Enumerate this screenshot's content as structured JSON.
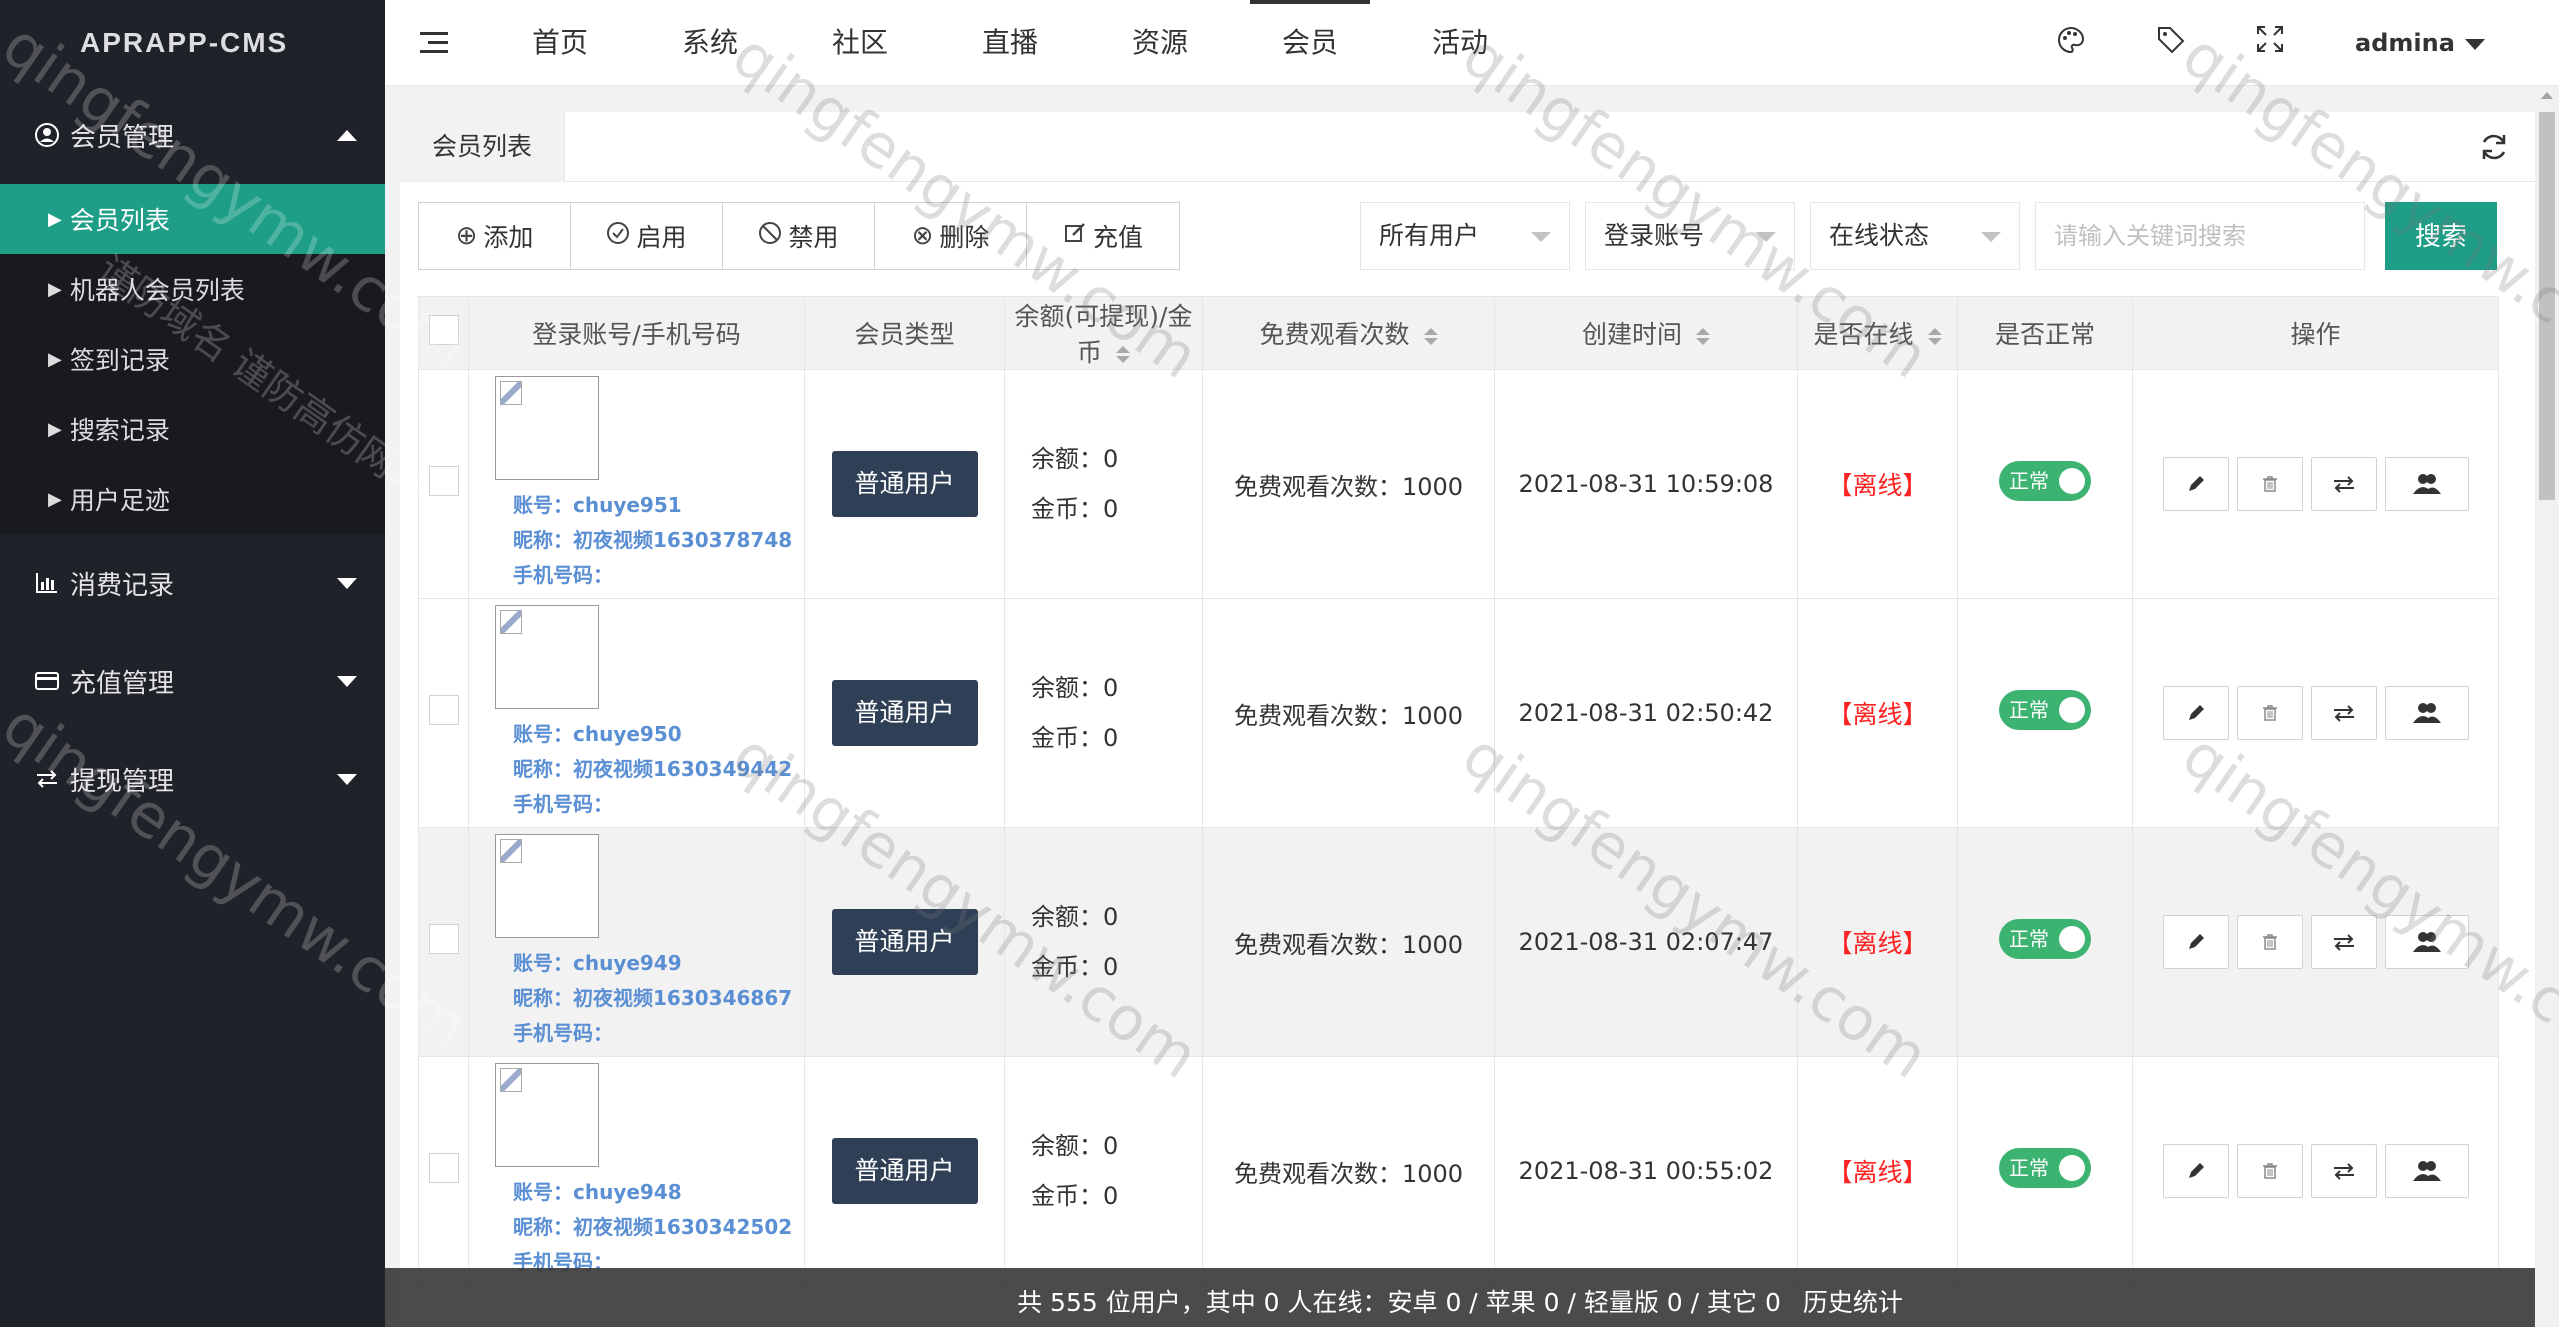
{
  "app": {
    "title": "APRAPP-CMS"
  },
  "sidebar": {
    "groups": [
      {
        "label": "会员管理",
        "icon": "user-circle-icon",
        "expanded": true,
        "items": [
          {
            "label": "会员列表",
            "active": true
          },
          {
            "label": "机器人会员列表"
          },
          {
            "label": "签到记录"
          },
          {
            "label": "搜索记录"
          },
          {
            "label": "用户足迹"
          }
        ]
      },
      {
        "label": "消费记录",
        "icon": "bar-chart-icon",
        "expanded": false
      },
      {
        "label": "充值管理",
        "icon": "card-icon",
        "expanded": false
      },
      {
        "label": "提现管理",
        "icon": "exchange-icon",
        "expanded": false
      }
    ]
  },
  "header": {
    "nav": [
      "首页",
      "系统",
      "社区",
      "直播",
      "资源",
      "会员",
      "活动"
    ],
    "active_nav": "会员",
    "user": "admina",
    "icons": [
      "palette-icon",
      "tag-icon",
      "fullscreen-icon"
    ]
  },
  "tabs": [
    {
      "label": "会员列表"
    }
  ],
  "toolbar": {
    "buttons": [
      {
        "label": "添加",
        "icon": "plus-circle-icon"
      },
      {
        "label": "启用",
        "icon": "check-circle-icon"
      },
      {
        "label": "禁用",
        "icon": "ban-icon"
      },
      {
        "label": "删除",
        "icon": "x-circle-icon"
      },
      {
        "label": "充值",
        "icon": "edit-icon"
      }
    ]
  },
  "filters": {
    "user_type": "所有用户",
    "account_type": "登录账号",
    "online_status": "在线状态",
    "keyword_placeholder": "请输入关键词搜索",
    "search_label": "搜索"
  },
  "table": {
    "columns": [
      "登录账号/手机号码",
      "会员类型",
      "余额(可提现)/金币",
      "免费观看次数",
      "创建时间",
      "是否在线",
      "是否正常",
      "操作"
    ],
    "rows": [
      {
        "account": "账号：chuye951",
        "nickname": "昵称：初夜视频1630378748",
        "phone": "手机号码：",
        "type": "普通用户",
        "balance": "余额：0",
        "coins": "金币：0",
        "free": "免费观看次数：1000",
        "created": "2021-08-31 10:59:08",
        "online": "【离线】",
        "status": "正常"
      },
      {
        "account": "账号：chuye950",
        "nickname": "昵称：初夜视频1630349442",
        "phone": "手机号码：",
        "type": "普通用户",
        "balance": "余额：0",
        "coins": "金币：0",
        "free": "免费观看次数：1000",
        "created": "2021-08-31 02:50:42",
        "online": "【离线】",
        "status": "正常"
      },
      {
        "account": "账号：chuye949",
        "nickname": "昵称：初夜视频1630346867",
        "phone": "手机号码：",
        "type": "普通用户",
        "balance": "余额：0",
        "coins": "金币：0",
        "free": "免费观看次数：1000",
        "created": "2021-08-31 02:07:47",
        "online": "【离线】",
        "status": "正常"
      },
      {
        "account": "账号：chuye948",
        "nickname": "昵称：初夜视频1630342502",
        "phone": "手机号码：",
        "type": "普通用户",
        "balance": "余额：0",
        "coins": "金币：0",
        "free": "免费观看次数：1000",
        "created": "2021-08-31 00:55:02",
        "online": "【离线】",
        "status": "正常"
      }
    ]
  },
  "footer": {
    "summary": "共 555 位用户，其中 0 人在线：安卓 0 / 苹果 0 / 轻量版 0 / 其它 0",
    "history": "历史统计"
  },
  "watermark": "qingfengymw.com",
  "watermark2": "谨防域名 谨防高仿网站",
  "colors": {
    "accent": "#1e9e87",
    "sidebar": "#20222a",
    "type_button": "#2f4056",
    "offline": "#ff2222",
    "switch_on": "#3cb371"
  }
}
